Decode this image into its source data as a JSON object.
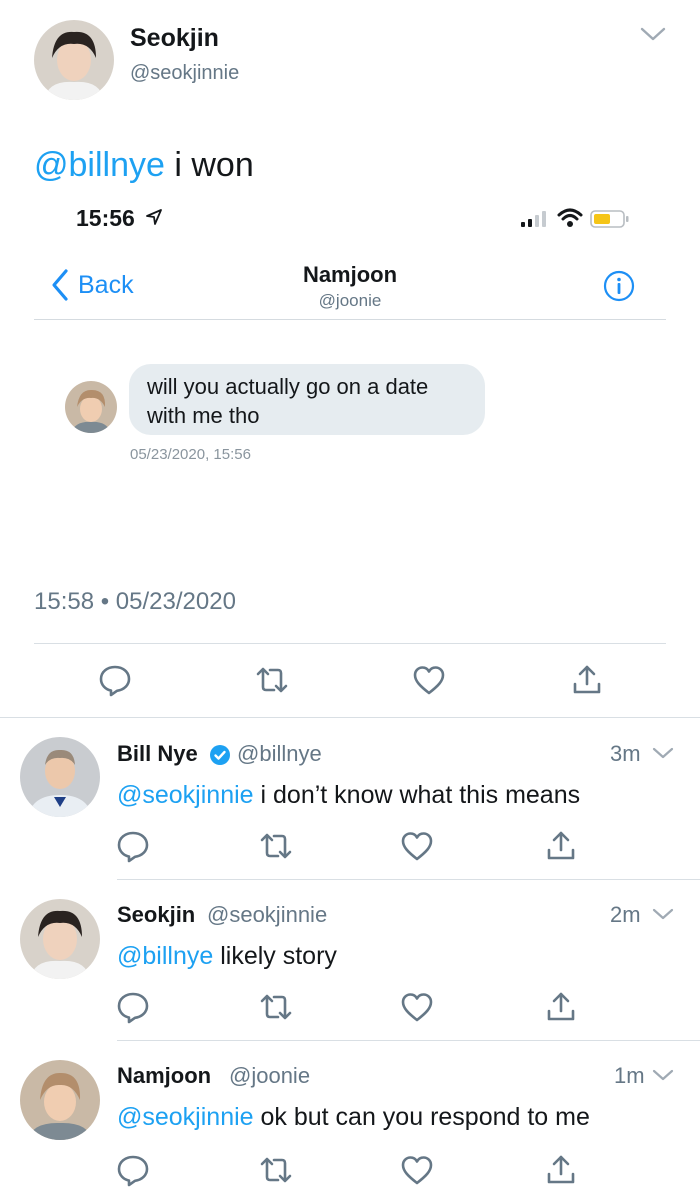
{
  "main_tweet": {
    "name": "Seokjin",
    "handle": "@seokjinnie",
    "mention": "@billnye",
    "text": " i won",
    "timestamp": "15:58 • 05/23/2020"
  },
  "embedded_screenshot": {
    "status_time": "15:56",
    "back_label": "Back",
    "contact_name": "Namjoon",
    "contact_handle": "@joonie",
    "message": "will you actually go on a date with me tho",
    "message_date": "05/23/2020, 15:56"
  },
  "replies": [
    {
      "name": "Bill Nye",
      "verified": true,
      "handle": "@billnye",
      "time": "3m",
      "mention": "@seokjinnie",
      "text": " i don’t know what this means"
    },
    {
      "name": "Seokjin",
      "verified": false,
      "handle": "@seokjinnie",
      "time": "2m",
      "mention": "@billnye",
      "text": " likely story"
    },
    {
      "name": "Namjoon",
      "verified": false,
      "handle": "@joonie",
      "time": "1m",
      "mention": "@seokjinnie",
      "text": " ok but can you respond to me"
    }
  ],
  "colors": {
    "link": "#1da1f2",
    "secondary": "#657786",
    "ios_blue": "#1d8ff5",
    "bubble": "#e6ecf0"
  },
  "icons": [
    "reply-icon",
    "retweet-icon",
    "like-icon",
    "share-icon",
    "chevron-down-icon",
    "verified-badge-icon",
    "info-icon",
    "location-arrow-icon",
    "signal-icon",
    "wifi-icon",
    "battery-icon"
  ]
}
